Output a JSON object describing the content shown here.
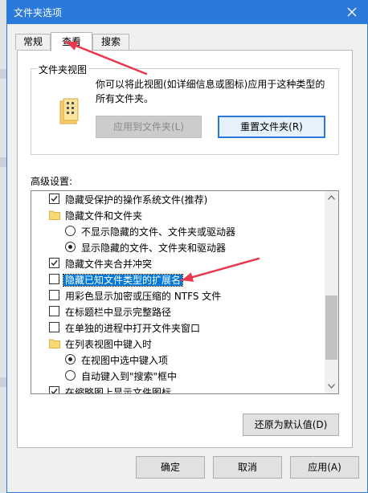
{
  "window": {
    "title": "文件夹选项"
  },
  "tabs": [
    {
      "label": "常规",
      "active": false
    },
    {
      "label": "查看",
      "active": true
    },
    {
      "label": "搜索",
      "active": false
    }
  ],
  "folder_views": {
    "title": "文件夹视图",
    "description": "你可以将此视图(如详细信息或图标)应用于这种类型的所有文件夹。",
    "apply_button": "应用到文件夹(L)",
    "reset_button": "重置文件夹(R)"
  },
  "advanced": {
    "label": "高级设置:",
    "items": [
      {
        "type": "checkbox",
        "checked": true,
        "label": "隐藏受保护的操作系统文件(推荐)"
      },
      {
        "type": "folder",
        "label": "隐藏文件和文件夹"
      },
      {
        "type": "radio",
        "checked": false,
        "label": "不显示隐藏的文件、文件夹或驱动器"
      },
      {
        "type": "radio",
        "checked": true,
        "label": "显示隐藏的文件、文件夹和驱动器"
      },
      {
        "type": "checkbox",
        "checked": true,
        "label": "隐藏文件夹合并冲突"
      },
      {
        "type": "checkbox",
        "checked": false,
        "label": "隐藏已知文件类型的扩展名",
        "selected": true
      },
      {
        "type": "checkbox",
        "checked": false,
        "label": "用彩色显示加密或压缩的 NTFS 文件"
      },
      {
        "type": "checkbox",
        "checked": false,
        "label": "在标题栏中显示完整路径"
      },
      {
        "type": "checkbox",
        "checked": false,
        "label": "在单独的进程中打开文件夹窗口"
      },
      {
        "type": "folder",
        "label": "在列表视图中键入时"
      },
      {
        "type": "radio",
        "checked": true,
        "label": "在视图中选中键入项"
      },
      {
        "type": "radio",
        "checked": false,
        "label": "自动键入到\"搜索\"框中"
      },
      {
        "type": "checkbox",
        "checked": true,
        "label": "在缩略图上显示文件图标"
      }
    ]
  },
  "restore_defaults_button": "还原为默认值(D)",
  "footer": {
    "ok": "确定",
    "cancel": "取消",
    "apply": "应用(A)"
  },
  "colors": {
    "titlebar": "#2b79d8",
    "selection": "#0078d7",
    "annotation_arrow": "#e8394e"
  }
}
